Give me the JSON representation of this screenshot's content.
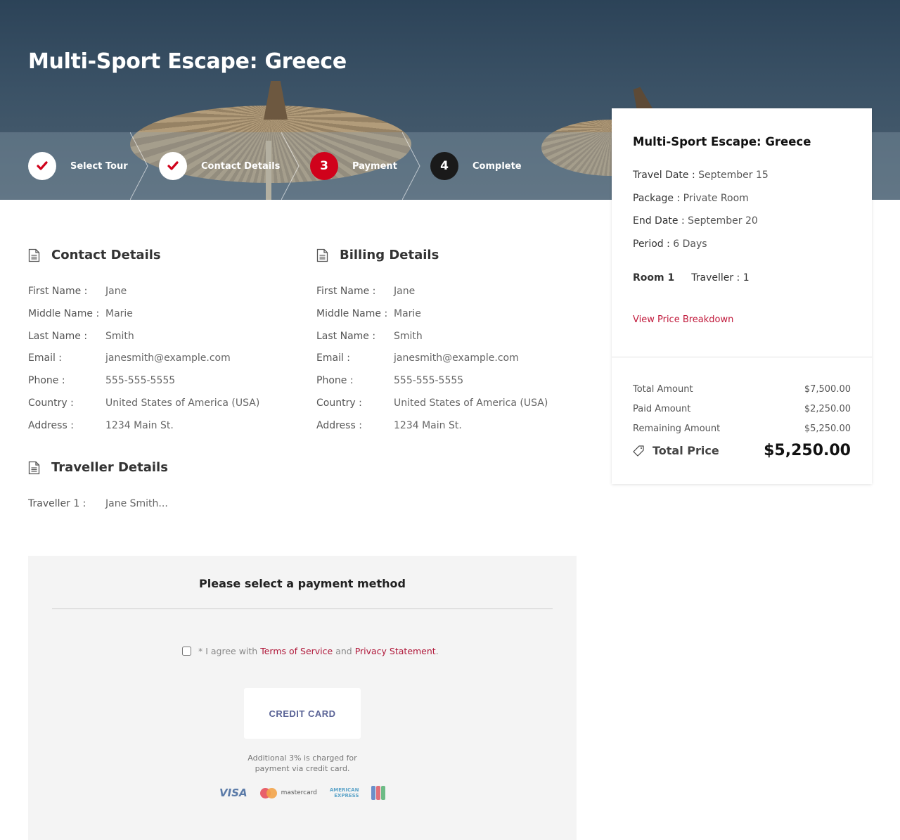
{
  "page": {
    "title": "Multi-Sport Escape: Greece"
  },
  "steps": [
    {
      "number": "1",
      "label": "Select Tour",
      "state": "done"
    },
    {
      "number": "2",
      "label": "Contact Details",
      "state": "done"
    },
    {
      "number": "3",
      "label": "Payment",
      "state": "active"
    },
    {
      "number": "4",
      "label": "Complete",
      "state": "pending"
    }
  ],
  "summary": {
    "title": "Multi-Sport Escape: Greece",
    "info": [
      {
        "label": "Travel Date :",
        "value": "September 15"
      },
      {
        "label": "Package :",
        "value": "Private Room"
      },
      {
        "label": "End Date :",
        "value": "September 20"
      },
      {
        "label": "Period :",
        "value": "6 Days"
      }
    ],
    "room_label": "Room 1",
    "traveller_label": "Traveller : 1",
    "breakdown_link": "View Price Breakdown",
    "prices": [
      {
        "label": "Total Amount",
        "value": "$7,500.00"
      },
      {
        "label": "Paid Amount",
        "value": "$2,250.00"
      },
      {
        "label": "Remaining Amount",
        "value": "$5,250.00"
      }
    ],
    "total_label": "Total Price",
    "total_value": "$5,250.00"
  },
  "contact": {
    "heading": "Contact Details",
    "fields": [
      {
        "label": "First Name :",
        "value": "Jane"
      },
      {
        "label": "Middle Name :",
        "value": "Marie"
      },
      {
        "label": "Last Name :",
        "value": "Smith"
      },
      {
        "label": "Email :",
        "value": "janesmith@example.com"
      },
      {
        "label": "Phone :",
        "value": "555-555-5555"
      },
      {
        "label": "Country :",
        "value": "United States of America (USA)"
      },
      {
        "label": "Address :",
        "value": "1234 Main St."
      }
    ]
  },
  "billing": {
    "heading": "Billing Details",
    "fields": [
      {
        "label": "First Name :",
        "value": "Jane"
      },
      {
        "label": "Middle Name :",
        "value": "Marie"
      },
      {
        "label": "Last Name :",
        "value": "Smith"
      },
      {
        "label": "Email :",
        "value": "janesmith@example.com"
      },
      {
        "label": "Phone :",
        "value": "555-555-5555"
      },
      {
        "label": "Country :",
        "value": "United States of America (USA)"
      },
      {
        "label": "Address :",
        "value": "1234 Main St."
      }
    ]
  },
  "traveller": {
    "heading": "Traveller Details",
    "fields": [
      {
        "label": "Traveller 1 :",
        "value": "Jane Smith..."
      }
    ]
  },
  "payment": {
    "heading": "Please select a payment method",
    "agree_prefix": "* I agree with ",
    "terms_link": "Terms of Service",
    "agree_mid": " and ",
    "privacy_link": "Privacy Statement",
    "agree_suffix": ".",
    "agree_checked": false,
    "credit_card_label": "CREDIT CARD",
    "fee_note_line1": "Additional 3% is charged for",
    "fee_note_line2": "payment via credit card.",
    "card_logos": {
      "visa": "VISA",
      "mastercard": "mastercard",
      "amex_line1": "AMERICAN",
      "amex_line2": "EXPRESS"
    }
  },
  "colors": {
    "accent": "#d0021b",
    "link": "#c0183a",
    "credit_card_text": "#5a6396"
  }
}
